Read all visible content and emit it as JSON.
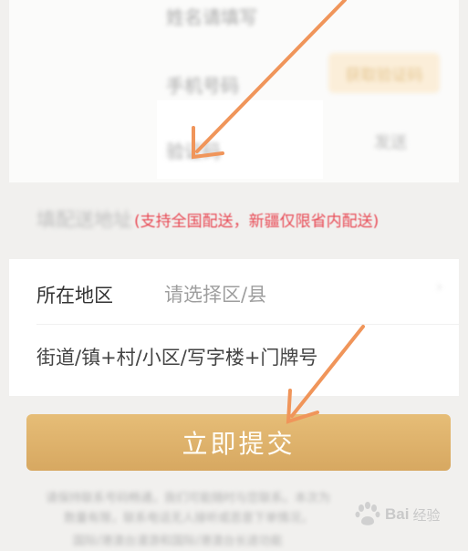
{
  "form": {
    "name_placeholder": "姓名请填写",
    "phone_placeholder": "手机号码",
    "get_code_label": "获取验证码",
    "code_placeholder": "验证码",
    "send_label": "发送"
  },
  "address": {
    "section_title": "填配送地址",
    "section_note": "(支持全国配送，新疆仅限省内配送)",
    "region_label": "所在地区",
    "region_placeholder": "请选择区/县",
    "street_placeholder": "街道/镇+村/小区/写字楼+门牌号"
  },
  "submit": {
    "label": "立即提交"
  },
  "disclaimer": {
    "line1": "请保持联系号码畅通，我们可能随时与您联系。本次为",
    "line2": "数量有限，联系电话无人接听或恶意下单情况，",
    "line3": "国际/港澳台漫游和国际/港澳台长途功能"
  },
  "watermark": {
    "brand": "Bai",
    "sub": "经验"
  },
  "colors": {
    "accent": "#d9aa63",
    "note": "#e84a55",
    "arrow": "#f0955a"
  }
}
